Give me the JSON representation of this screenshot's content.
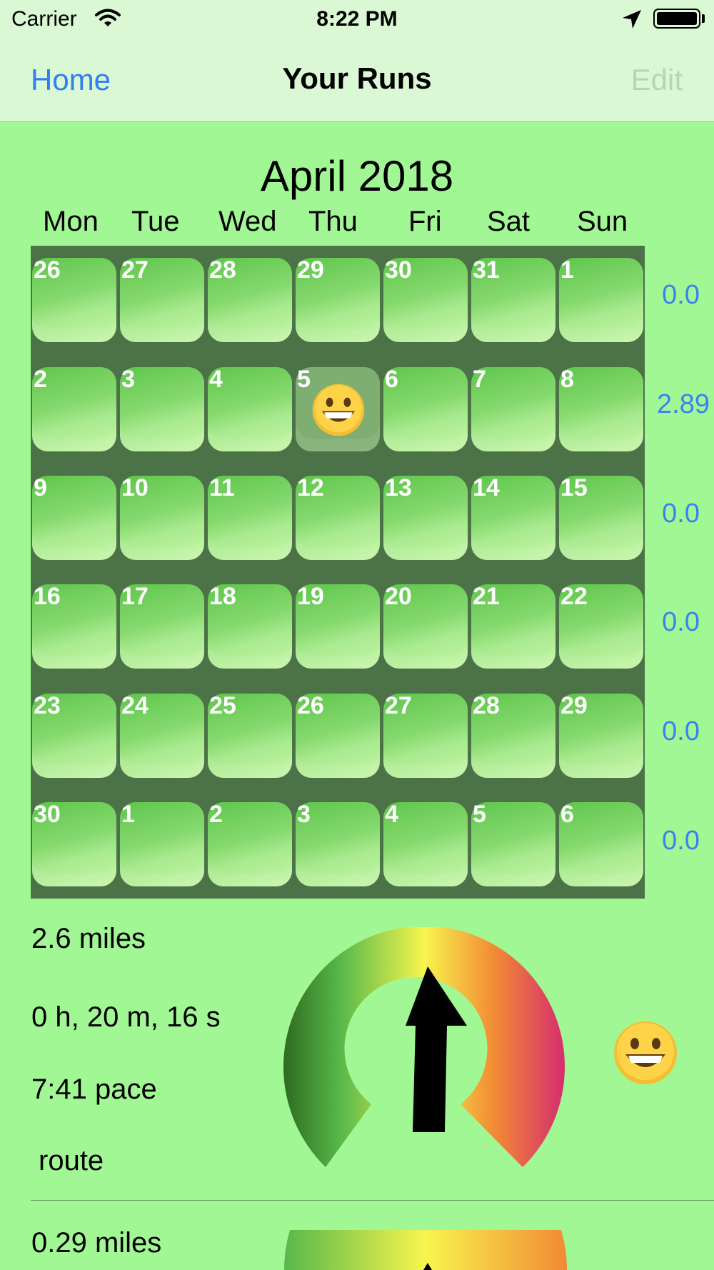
{
  "status_bar": {
    "carrier": "Carrier",
    "time": "8:22 PM"
  },
  "nav": {
    "back_label": "Home",
    "title": "Your Runs",
    "edit_label": "Edit"
  },
  "calendar": {
    "month_title": "April 2018",
    "weekdays": [
      "Mon",
      "Tue",
      "Wed",
      "Thu",
      "Fri",
      "Sat",
      "Sun"
    ],
    "weeks": [
      {
        "days": [
          "26",
          "27",
          "28",
          "29",
          "30",
          "31",
          "1"
        ],
        "total": "0.0"
      },
      {
        "days": [
          "2",
          "3",
          "4",
          "5",
          "6",
          "7",
          "8"
        ],
        "total": "2.89"
      },
      {
        "days": [
          "9",
          "10",
          "11",
          "12",
          "13",
          "14",
          "15"
        ],
        "total": "0.0"
      },
      {
        "days": [
          "16",
          "17",
          "18",
          "19",
          "20",
          "21",
          "22"
        ],
        "total": "0.0"
      },
      {
        "days": [
          "23",
          "24",
          "25",
          "26",
          "27",
          "28",
          "29"
        ],
        "total": "0.0"
      },
      {
        "days": [
          "30",
          "1",
          "2",
          "3",
          "4",
          "5",
          "6"
        ],
        "total": "0.0"
      }
    ],
    "selected_day_with_run": "5"
  },
  "runs": [
    {
      "distance": "2.6 miles",
      "time": "0 h, 20 m, 16 s",
      "pace": "7:41 pace",
      "route_label": "route",
      "mood": "grinning-face"
    },
    {
      "distance": "0.29 miles"
    }
  ],
  "colors": {
    "background": "#a2f795",
    "accent": "#2f7ef5",
    "grid": "#4c7348"
  }
}
